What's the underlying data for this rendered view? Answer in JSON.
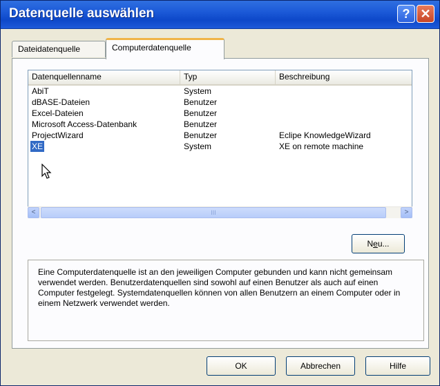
{
  "window": {
    "title": "Datenquelle auswählen",
    "help_glyph": "?",
    "close_glyph": "✕"
  },
  "tabs": [
    {
      "label": "Dateidatenquelle",
      "active": false
    },
    {
      "label": "Computerdatenquelle",
      "active": true
    }
  ],
  "list": {
    "columns": [
      "Datenquellenname",
      "Typ",
      "Beschreibung"
    ],
    "rows": [
      {
        "name": "AbiT",
        "type": "System",
        "desc": ""
      },
      {
        "name": "dBASE-Dateien",
        "type": "Benutzer",
        "desc": ""
      },
      {
        "name": "Excel-Dateien",
        "type": "Benutzer",
        "desc": ""
      },
      {
        "name": "Microsoft Access-Datenbank",
        "type": "Benutzer",
        "desc": ""
      },
      {
        "name": "ProjectWizard",
        "type": "Benutzer",
        "desc": "Eclipe KnowledgeWizard"
      },
      {
        "name": "XE",
        "type": "System",
        "desc": "XE on remote machine",
        "selected": true
      }
    ]
  },
  "scrollbar": {
    "left_glyph": "<",
    "right_glyph": ">",
    "thumb_glyph": "III"
  },
  "buttons": {
    "neu_prefix": "N",
    "neu_underline": "e",
    "neu_suffix": "u...",
    "ok": "OK",
    "cancel": "Abbrechen",
    "help": "Hilfe"
  },
  "info_text": "Eine Computerdatenquelle ist an den jeweiligen Computer gebunden und kann nicht gemeinsam verwendet werden. Benutzerdatenquellen sind sowohl auf einen Benutzer als auch auf einen Computer festgelegt. Systemdatenquellen können von allen Benutzern an einem Computer oder in einem Netzwerk verwendet werden.",
  "colors": {
    "title_bar": "#1c5ad8",
    "selection": "#316ac5",
    "dialog_bg": "#ece9d8"
  }
}
